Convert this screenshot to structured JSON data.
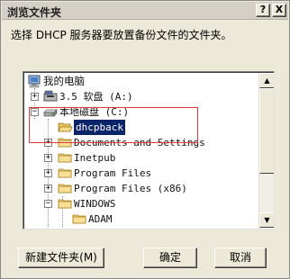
{
  "dialog": {
    "title": "浏览文件夹",
    "help_label": "?",
    "close_label": "X",
    "prompt": "选择 DHCP 服务器要放置备份文件的文件夹。"
  },
  "tree": {
    "items": [
      {
        "label": "我的电脑",
        "icon": "computer-icon",
        "expander": ""
      },
      {
        "label": "3.5 软盘 (A:)",
        "icon": "floppy-drive-icon",
        "expander": "+"
      },
      {
        "label": "本地磁盘 (C:)",
        "icon": "hard-disk-icon",
        "expander": "−"
      },
      {
        "label": "dhcpback",
        "icon": "folder-icon",
        "expander": "",
        "selected": true
      },
      {
        "label": "Documents and Settings",
        "icon": "folder-icon",
        "expander": "+"
      },
      {
        "label": "Inetpub",
        "icon": "folder-icon",
        "expander": "+"
      },
      {
        "label": "Program Files",
        "icon": "folder-icon",
        "expander": "+"
      },
      {
        "label": "Program Files (x86)",
        "icon": "folder-icon",
        "expander": "+"
      },
      {
        "label": "WINDOWS",
        "icon": "folder-icon",
        "expander": "−"
      },
      {
        "label": "ADAM",
        "icon": "folder-icon",
        "expander": ""
      }
    ]
  },
  "scrollbar": {
    "up_arrow": "▲",
    "down_arrow": "▼"
  },
  "buttons": {
    "new_folder": "新建文件夹(M)",
    "ok": "确定",
    "cancel": "取消"
  },
  "colors": {
    "selection": "#0a246a",
    "highlight_box": "#e03838",
    "dialog_bg": "#ece9d8"
  }
}
